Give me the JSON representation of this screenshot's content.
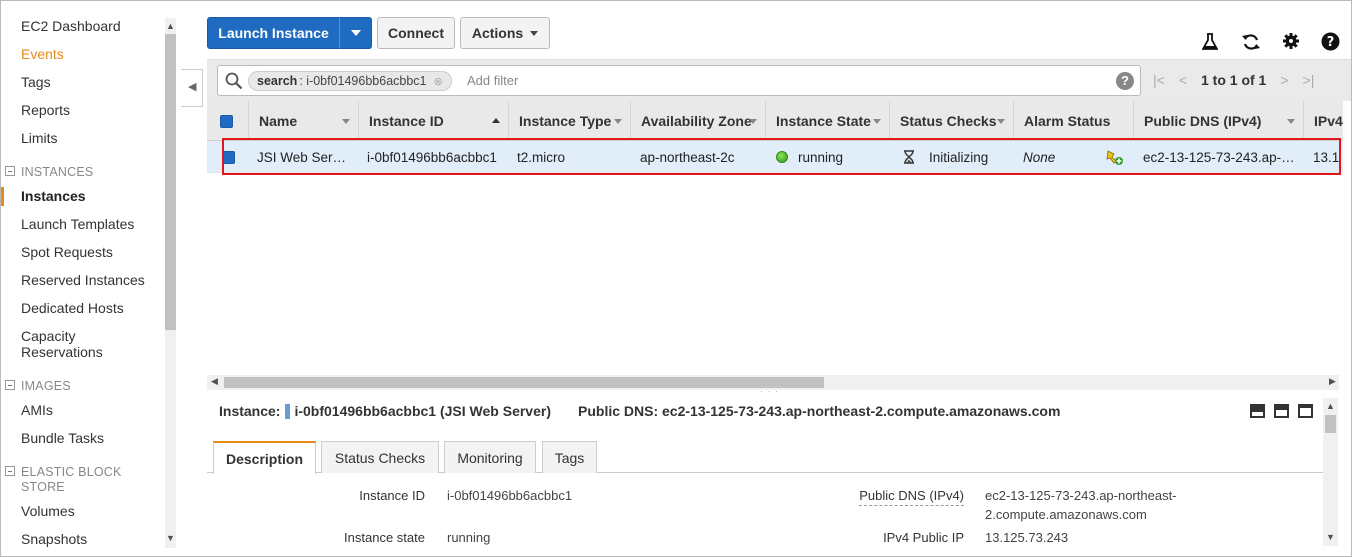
{
  "sidebar": {
    "items": [
      {
        "label": "EC2 Dashboard"
      },
      {
        "label": "Events"
      },
      {
        "label": "Tags"
      },
      {
        "label": "Reports"
      },
      {
        "label": "Limits"
      }
    ],
    "sections": [
      {
        "label": "INSTANCES"
      },
      {
        "label": "IMAGES"
      },
      {
        "label": "ELASTIC BLOCK"
      },
      {
        "label": "STORE"
      }
    ],
    "instance_items": [
      {
        "label": "Instances"
      },
      {
        "label": "Launch Templates"
      },
      {
        "label": "Spot Requests"
      },
      {
        "label": "Reserved Instances"
      },
      {
        "label": "Dedicated Hosts"
      },
      {
        "label": "Capacity"
      },
      {
        "label": "Reservations"
      }
    ],
    "image_items": [
      {
        "label": "AMIs"
      },
      {
        "label": "Bundle Tasks"
      }
    ],
    "ebs_items": [
      {
        "label": "Volumes"
      },
      {
        "label": "Snapshots"
      }
    ]
  },
  "toolbar": {
    "launch_label": "Launch Instance",
    "connect_label": "Connect",
    "actions_label": "Actions"
  },
  "filter": {
    "chip_key": "search",
    "chip_value": ": i-0bf01496bb6acbbc1",
    "add_filter": "Add filter",
    "pager_text": "1 to 1 of 1"
  },
  "table": {
    "headers": [
      "Name",
      "Instance ID",
      "Instance Type",
      "Availability Zone",
      "Instance State",
      "Status Checks",
      "Alarm Status",
      "Public DNS (IPv4)",
      "IPv4"
    ],
    "row": {
      "name": "JSI Web Ser…",
      "instance_id": "i-0bf01496bb6acbbc1",
      "instance_type": "t2.micro",
      "availability_zone": "ap-northeast-2c",
      "instance_state": "running",
      "status_checks": "Initializing",
      "alarm_status": "None",
      "public_dns": "ec2-13-125-73-243.ap-…",
      "ipv4": "13.1"
    }
  },
  "detail": {
    "instance_label": "Instance:",
    "instance_value": "i-0bf01496bb6acbbc1 (JSI Web Server)",
    "dns_label": "Public DNS:",
    "dns_value": "ec2-13-125-73-243.ap-northeast-2.compute.amazonaws.com",
    "tabs": [
      "Description",
      "Status Checks",
      "Monitoring",
      "Tags"
    ],
    "fields": {
      "instance_id_label": "Instance ID",
      "instance_id_value": "i-0bf01496bb6acbbc1",
      "instance_state_label": "Instance state",
      "instance_state_value": "running",
      "public_dns_label": "Public DNS (IPv4)",
      "public_dns_value_line1": "ec2-13-125-73-243.ap-northeast-",
      "public_dns_value_line2": "2.compute.amazonaws.com",
      "ipv4_label": "IPv4 Public IP",
      "ipv4_value": "13.125.73.243"
    }
  },
  "colors": {
    "accent_orange": "#e88a1a",
    "primary_blue": "#1f6bc1",
    "highlight_red": "#e1171b",
    "row_selected": "#e1edf9"
  }
}
